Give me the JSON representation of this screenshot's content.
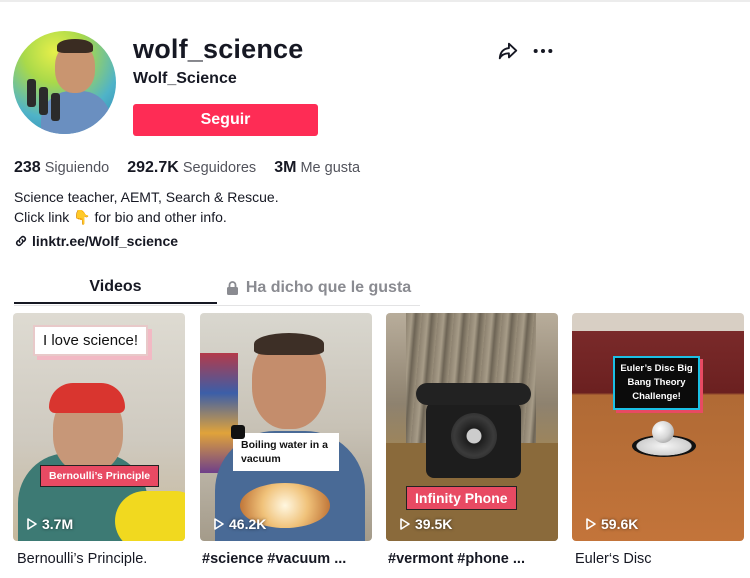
{
  "profile": {
    "username": "wolf_science",
    "nickname": "Wolf_Science",
    "follow_label": "Seguir"
  },
  "stats": [
    {
      "value": "238",
      "label": "Siguiendo"
    },
    {
      "value": "292.7K",
      "label": "Seguidores"
    },
    {
      "value": "3M",
      "label": "Me gusta"
    }
  ],
  "bio": {
    "line1": "Science teacher, AEMT, Search & Rescue.",
    "line2_prefix": "Click link",
    "line2_emoji": "👇",
    "line2_suffix": "for bio and other info."
  },
  "link": {
    "text": "linktr.ee/Wolf_science",
    "icon": "link-icon"
  },
  "tabs": [
    {
      "label": "Videos",
      "active": true
    },
    {
      "label": "Ha dicho que le gusta",
      "active": false,
      "icon": "lock-icon"
    }
  ],
  "icons": {
    "share": "share-icon",
    "more": "more-icon"
  },
  "colors": {
    "accent": "#fe2c55",
    "text": "#161823",
    "muted": "#8a8b91"
  },
  "videos": [
    {
      "views": "3.7M",
      "caption": "Bernoulli’s Principle.",
      "overlay": "I love science!",
      "overlay2": "Bernoulli’s Principle"
    },
    {
      "views": "46.2K",
      "caption": "#science #vacuum ...",
      "overlay": "Boiling water in a vacuum"
    },
    {
      "views": "39.5K",
      "caption": "#vermont #phone ...",
      "overlay": "Infinity Phone"
    },
    {
      "views": "59.6K",
      "caption": "Euler‘s Disc",
      "overlay": "Euler’s Disc Big Bang Theory Challenge!"
    }
  ]
}
